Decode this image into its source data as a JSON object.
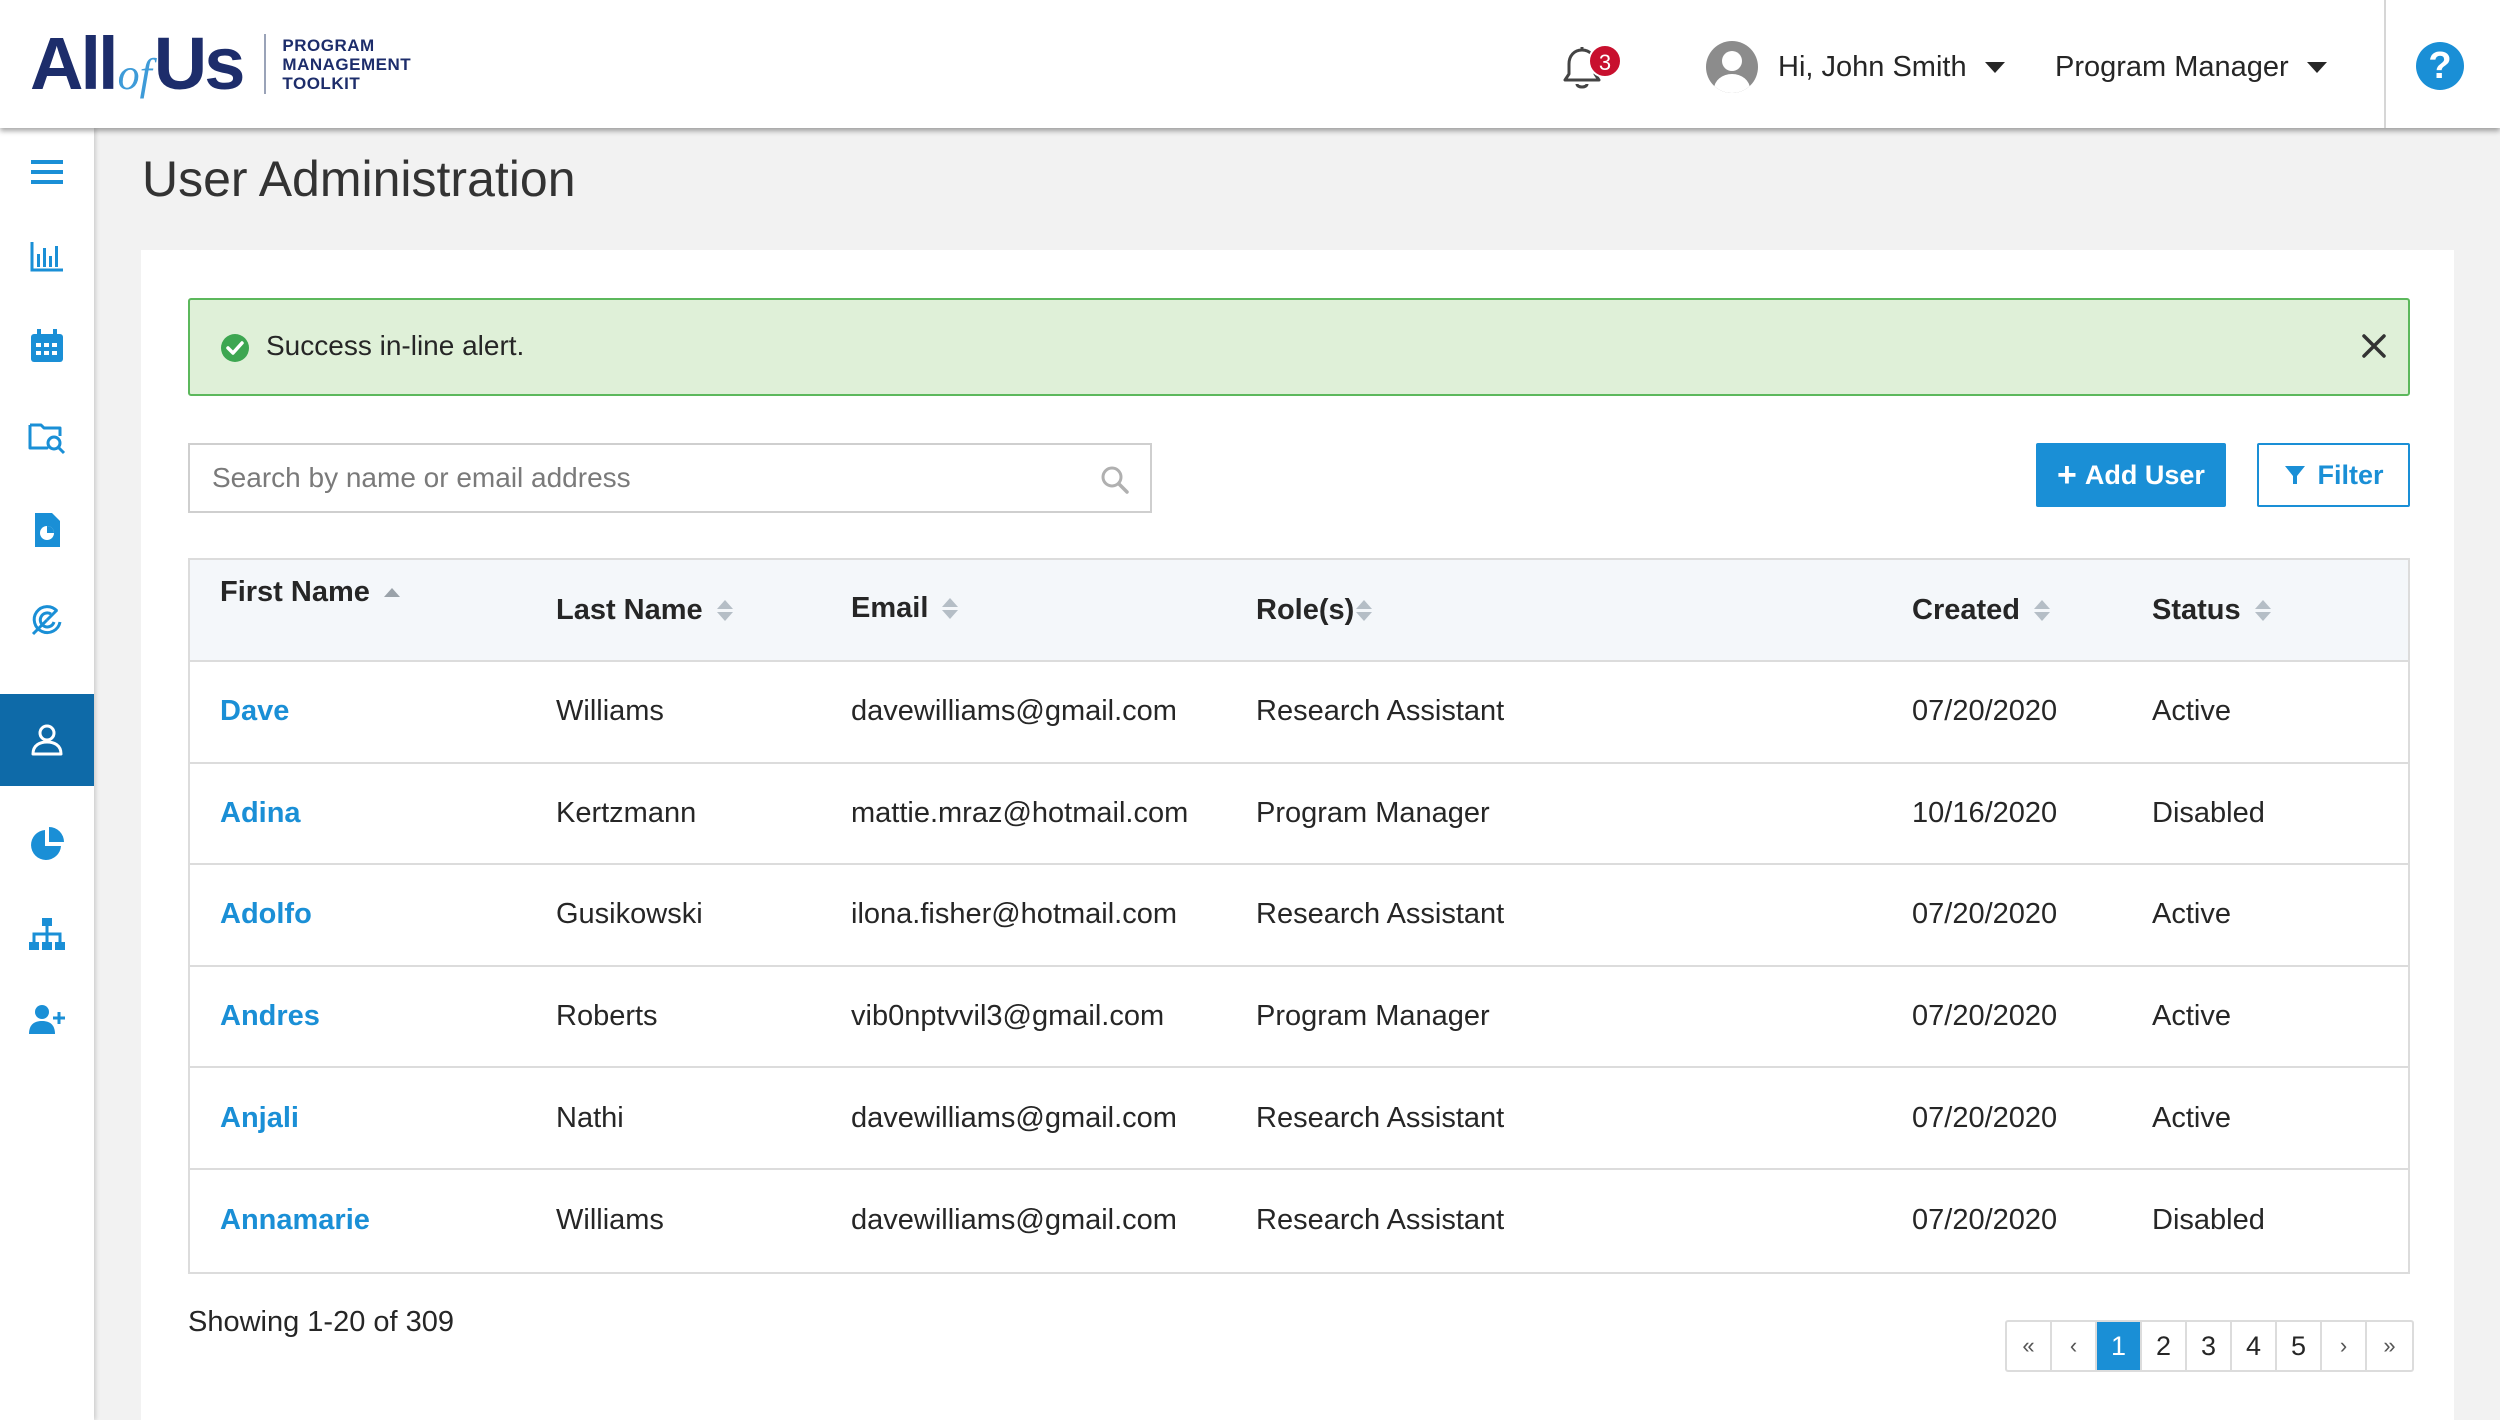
{
  "header": {
    "logo": {
      "all": "All",
      "of": "of",
      "us": "Us",
      "sub": [
        "PROGRAM",
        "MANAGEMENT",
        "TOOLKIT"
      ]
    },
    "notifications_count": "3",
    "user_greeting": "Hi, John Smith",
    "role": "Program Manager",
    "help_label": "?"
  },
  "sidebar": {
    "items": [
      {
        "name": "menu",
        "icon": "hamburger-icon"
      },
      {
        "name": "analytics",
        "icon": "bar-chart-icon"
      },
      {
        "name": "calendar",
        "icon": "calendar-icon"
      },
      {
        "name": "search-folder",
        "icon": "folder-search-icon"
      },
      {
        "name": "reports",
        "icon": "document-chart-icon"
      },
      {
        "name": "outreach",
        "icon": "target-arrow-icon"
      },
      {
        "name": "users",
        "icon": "user-icon",
        "active": true
      },
      {
        "name": "pie-chart",
        "icon": "pie-chart-icon"
      },
      {
        "name": "hierarchy",
        "icon": "sitemap-icon"
      },
      {
        "name": "add-user",
        "icon": "user-plus-icon"
      }
    ]
  },
  "page": {
    "title": "User Administration"
  },
  "alert": {
    "text": "Success in-line alert."
  },
  "search": {
    "placeholder": "Search by name or email address"
  },
  "toolbar": {
    "add_user": "Add User",
    "filter": "Filter"
  },
  "table": {
    "headers": {
      "first_name": "First Name",
      "last_name": "Last Name",
      "email": "Email",
      "roles": "Role(s)",
      "created": "Created",
      "status": "Status"
    },
    "rows": [
      {
        "first": "Dave",
        "last": "Williams",
        "email": "davewilliams@gmail.com",
        "role": "Research Assistant",
        "created": "07/20/2020",
        "status": "Active"
      },
      {
        "first": "Adina",
        "last": "Kertzmann",
        "email": "mattie.mraz@hotmail.com",
        "role": "Program Manager",
        "created": "10/16/2020",
        "status": "Disabled"
      },
      {
        "first": "Adolfo",
        "last": "Gusikowski",
        "email": "ilona.fisher@hotmail.com",
        "role": "Research Assistant",
        "created": "07/20/2020",
        "status": "Active"
      },
      {
        "first": "Andres",
        "last": "Roberts",
        "email": "vib0nptvvil3@gmail.com",
        "role": "Program Manager",
        "created": "07/20/2020",
        "status": "Active"
      },
      {
        "first": "Anjali",
        "last": "Nathi",
        "email": "davewilliams@gmail.com",
        "role": "Research Assistant",
        "created": "07/20/2020",
        "status": "Active"
      },
      {
        "first": "Annamarie",
        "last": "Williams",
        "email": "davewilliams@gmail.com",
        "role": "Research Assistant",
        "created": "07/20/2020",
        "status": "Disabled"
      }
    ]
  },
  "footer": {
    "showing": "Showing 1-20 of 309",
    "pagination": {
      "first": "«",
      "prev": "‹",
      "pages": [
        "1",
        "2",
        "3",
        "4",
        "5"
      ],
      "current": "1",
      "next": "›",
      "last": "»"
    }
  },
  "colors": {
    "brand_blue": "#1a8fd6",
    "navy": "#1d2d6b",
    "active_nav": "#0e6aa8",
    "success_bg": "#dff0d8",
    "success_border": "#5cb85c",
    "badge_red": "#c8102e"
  }
}
